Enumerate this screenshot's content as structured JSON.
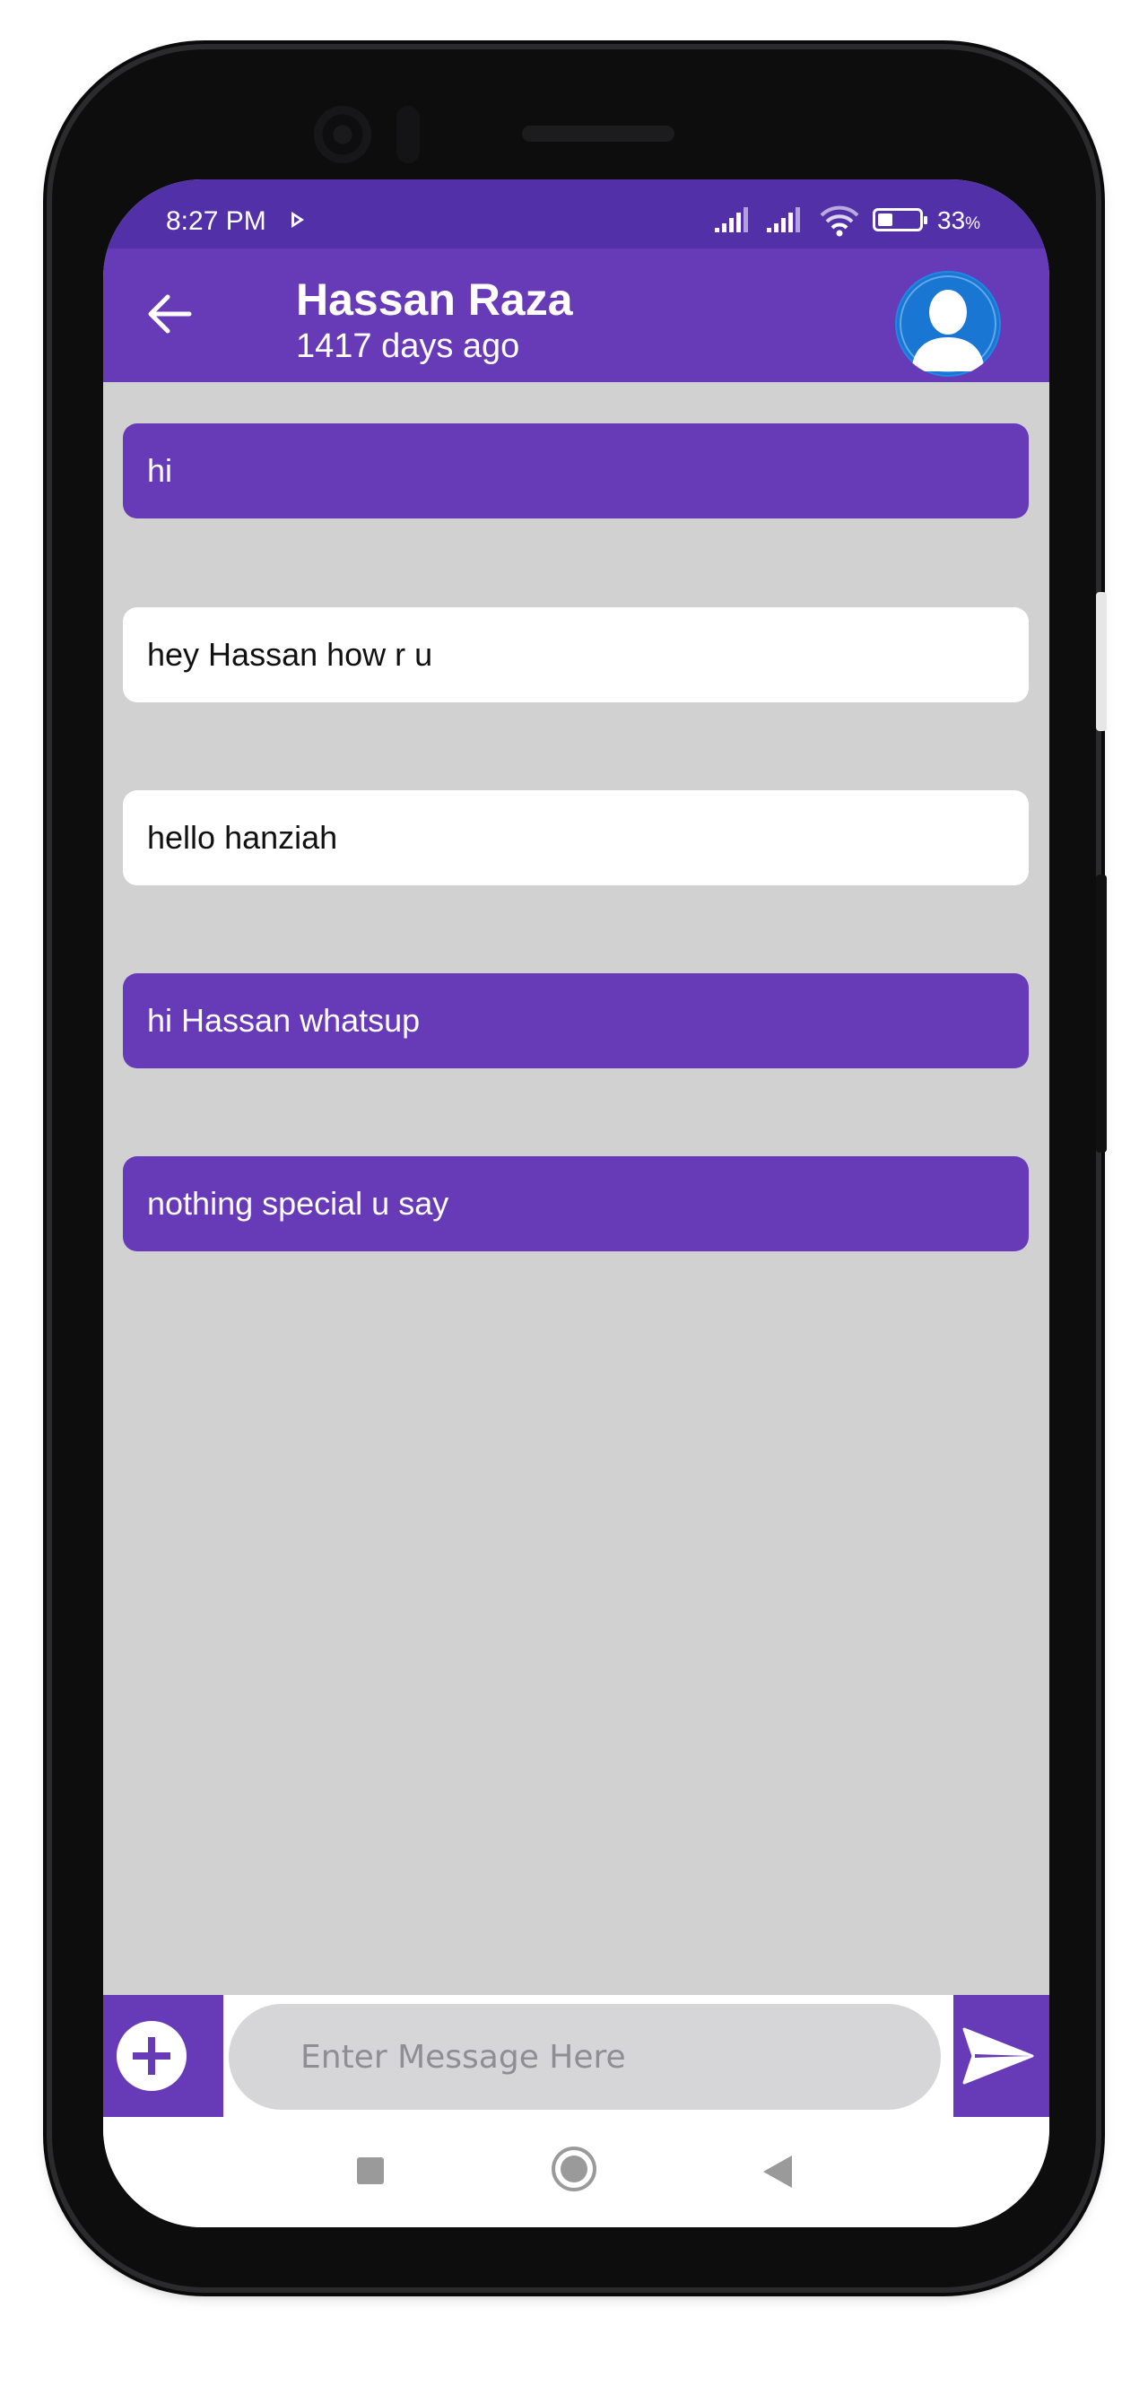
{
  "status_bar": {
    "time": "8:27 PM",
    "battery_percent": "33",
    "battery_unit": "%"
  },
  "header": {
    "contact_name": "Hassan Raza",
    "last_seen": "1417 days ago",
    "back_icon": "arrow-left-icon",
    "avatar_icon": "person-silhouette-icon"
  },
  "messages": [
    {
      "text": "hi",
      "type": "sent"
    },
    {
      "text": "hey Hassan how r u",
      "type": "received"
    },
    {
      "text": "hello hanziah",
      "type": "received"
    },
    {
      "text": "hi Hassan whatsup",
      "type": "sent"
    },
    {
      "text": "nothing special u say",
      "type": "sent"
    }
  ],
  "composer": {
    "placeholder": "Enter Message Here",
    "value": "",
    "attach_icon": "plus-circle-icon",
    "send_icon": "send-icon"
  },
  "nav": {
    "recent_icon": "square-icon",
    "home_icon": "circle-icon",
    "back_icon": "triangle-back-icon"
  },
  "colors": {
    "primary": "#673ab7",
    "status_bar": "#5231a8",
    "chat_background": "#d1d1d1",
    "received_bubble": "#ffffff"
  }
}
